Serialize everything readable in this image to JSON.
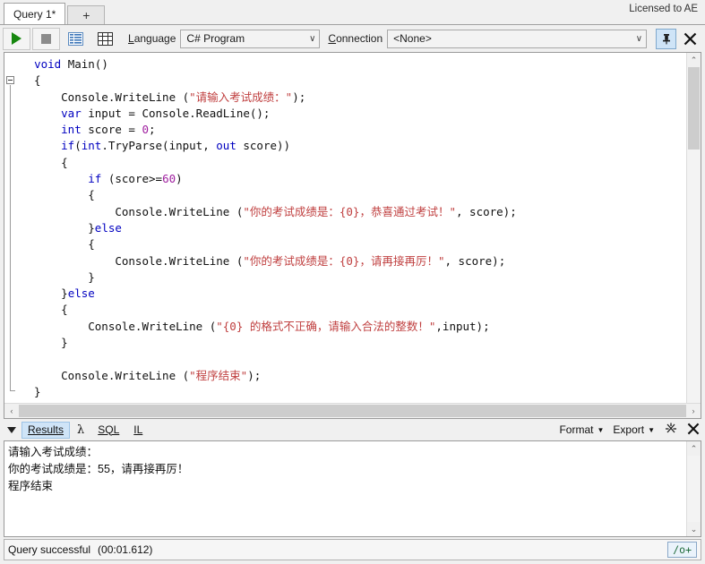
{
  "window": {
    "license": "Licensed to AE"
  },
  "tabs": {
    "items": [
      {
        "label": "Query 1*"
      }
    ],
    "new_tab_label": "+"
  },
  "toolbar": {
    "run_icon": "play-icon",
    "stop_icon": "stop-icon",
    "results_grid_icon": "results-view-icon",
    "table_grid_icon": "table-grid-icon",
    "language_label": "Language",
    "language_value": "C# Program",
    "connection_label": "Connection",
    "connection_value": "<None>",
    "pin_icon": "pin-icon",
    "close_icon": "close-icon",
    "dropdown_caret": "∨"
  },
  "editor": {
    "lines": [
      [
        {
          "t": "  ",
          "c": "pl"
        },
        {
          "t": "void",
          "c": "kw"
        },
        {
          "t": " Main()",
          "c": "pl"
        }
      ],
      [
        {
          "t": "  {",
          "c": "pl"
        }
      ],
      [
        {
          "t": "      Console.WriteLine (",
          "c": "pl"
        },
        {
          "t": "\"请输入考试成绩：\"",
          "c": "str"
        },
        {
          "t": ");",
          "c": "pl"
        }
      ],
      [
        {
          "t": "      ",
          "c": "pl"
        },
        {
          "t": "var",
          "c": "kw"
        },
        {
          "t": " input = Console.ReadLine();",
          "c": "pl"
        }
      ],
      [
        {
          "t": "      ",
          "c": "pl"
        },
        {
          "t": "int",
          "c": "kw"
        },
        {
          "t": " score = ",
          "c": "pl"
        },
        {
          "t": "0",
          "c": "num"
        },
        {
          "t": ";",
          "c": "pl"
        }
      ],
      [
        {
          "t": "      ",
          "c": "pl"
        },
        {
          "t": "if",
          "c": "kw"
        },
        {
          "t": "(",
          "c": "pl"
        },
        {
          "t": "int",
          "c": "kw"
        },
        {
          "t": ".TryParse(input, ",
          "c": "pl"
        },
        {
          "t": "out",
          "c": "kw"
        },
        {
          "t": " score))",
          "c": "pl"
        }
      ],
      [
        {
          "t": "      {",
          "c": "pl"
        }
      ],
      [
        {
          "t": "          ",
          "c": "pl"
        },
        {
          "t": "if",
          "c": "kw"
        },
        {
          "t": " (score>=",
          "c": "pl"
        },
        {
          "t": "60",
          "c": "num"
        },
        {
          "t": ")",
          "c": "pl"
        }
      ],
      [
        {
          "t": "          {",
          "c": "pl"
        }
      ],
      [
        {
          "t": "              Console.WriteLine (",
          "c": "pl"
        },
        {
          "t": "\"你的考试成绩是：{0}，恭喜通过考试！\"",
          "c": "str"
        },
        {
          "t": ", score);",
          "c": "pl"
        }
      ],
      [
        {
          "t": "          }",
          "c": "pl"
        },
        {
          "t": "else",
          "c": "kw"
        }
      ],
      [
        {
          "t": "          {",
          "c": "pl"
        }
      ],
      [
        {
          "t": "              Console.WriteLine (",
          "c": "pl"
        },
        {
          "t": "\"你的考试成绩是：{0}，请再接再厉！\"",
          "c": "str"
        },
        {
          "t": ", score);",
          "c": "pl"
        }
      ],
      [
        {
          "t": "          }",
          "c": "pl"
        }
      ],
      [
        {
          "t": "      }",
          "c": "pl"
        },
        {
          "t": "else",
          "c": "kw"
        }
      ],
      [
        {
          "t": "      {",
          "c": "pl"
        }
      ],
      [
        {
          "t": "          Console.WriteLine (",
          "c": "pl"
        },
        {
          "t": "\"{0} 的格式不正确，请输入合法的整数！\"",
          "c": "str"
        },
        {
          "t": ",input);",
          "c": "pl"
        }
      ],
      [
        {
          "t": "      }",
          "c": "pl"
        }
      ],
      [
        {
          "t": "",
          "c": "pl"
        }
      ],
      [
        {
          "t": "      Console.WriteLine (",
          "c": "pl"
        },
        {
          "t": "\"程序结束\"",
          "c": "str"
        },
        {
          "t": ");",
          "c": "pl"
        }
      ],
      [
        {
          "t": "  }",
          "c": "pl"
        }
      ]
    ]
  },
  "results": {
    "collapse_icon": "triangle-down-icon",
    "tabs": [
      {
        "label": "Results",
        "active": true
      },
      {
        "label": "λ",
        "active": false
      },
      {
        "label": "SQL",
        "active": false
      },
      {
        "label": "IL",
        "active": false
      }
    ],
    "format_label": "Format",
    "export_label": "Export",
    "sparkle_icon": "sparkle-icon",
    "close_icon": "close-icon",
    "output_lines": [
      "请输入考试成绩：",
      "你的考试成绩是：55，请再接再厉！",
      "程序结束"
    ]
  },
  "status": {
    "message": "Query successful",
    "elapsed": "(00:01.612)",
    "optimization_badge": "/o+"
  },
  "scroll": {
    "up_arrow": "⌃",
    "down_arrow": "⌄",
    "left_arrow": "‹",
    "right_arrow": "›"
  }
}
